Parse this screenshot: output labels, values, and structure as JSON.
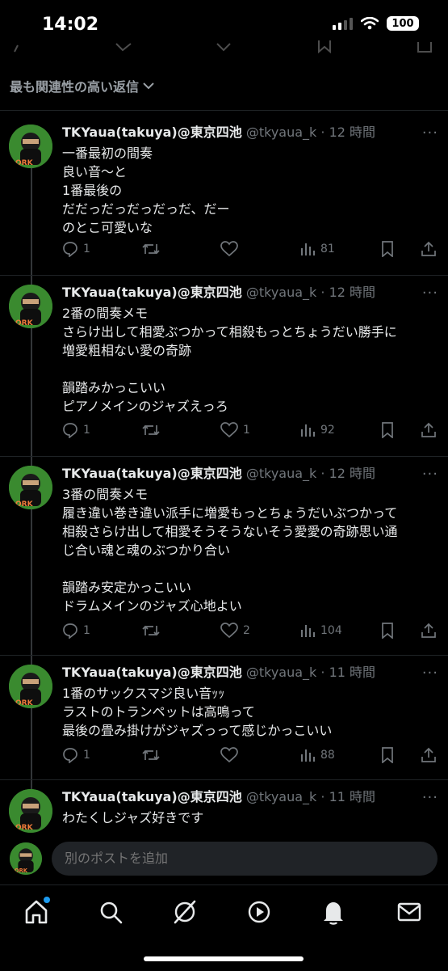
{
  "status": {
    "time": "14:02",
    "battery": "100"
  },
  "sort_label": "最も関連性の高い返信",
  "author": {
    "name": "TKYaua(takuya)@東京四池",
    "handle": "@tkyaua_k"
  },
  "posts": [
    {
      "time": "12 時間",
      "lines": [
        "一番最初の間奏",
        "良い音〜と",
        "1番最後の",
        "だだっだっだっだっだ、だー",
        "のとこ可愛いな"
      ],
      "replies": "1",
      "reposts": "",
      "likes": "",
      "views": "81"
    },
    {
      "time": "12 時間",
      "lines": [
        "2番の間奏メモ",
        "さらけ出して相愛ぶつかって相殺もっとちょうだい勝手に",
        "増愛粗相ない愛の奇跡",
        "",
        "韻踏みかっこいい",
        "ピアノメインのジャズえっろ"
      ],
      "replies": "1",
      "reposts": "",
      "likes": "1",
      "views": "92"
    },
    {
      "time": "12 時間",
      "lines": [
        "3番の間奏メモ",
        "履き違い巻き違い派手に増愛もっとちょうだいぶつかって",
        "相殺さらけ出して相愛そうそうないそう愛愛の奇跡思い通",
        "じ合い魂と魂のぶつかり合い",
        "",
        "韻踏み安定かっこいい",
        "ドラムメインのジャズ心地よい"
      ],
      "replies": "1",
      "reposts": "",
      "likes": "2",
      "views": "104"
    },
    {
      "time": "11 時間",
      "lines": [
        "1番のサックスマジ良い音ｯｯ",
        "ラストのトランペットは高鳴って",
        "最後の畳み掛けがジャズっって感じかっこいい"
      ],
      "replies": "1",
      "reposts": "",
      "likes": "",
      "views": "88"
    },
    {
      "time": "11 時間",
      "lines": [
        "わたくしジャズ好きです"
      ],
      "replies": "",
      "reposts": "",
      "likes": "",
      "views": ""
    }
  ],
  "composer": {
    "placeholder": "別のポストを追加"
  },
  "tabs": [
    {
      "name": "home",
      "icon": "home-icon",
      "badge": true
    },
    {
      "name": "search",
      "icon": "search-icon",
      "badge": false
    },
    {
      "name": "grok",
      "icon": "grok-icon",
      "badge": false
    },
    {
      "name": "video",
      "icon": "play-icon",
      "badge": false
    },
    {
      "name": "notifications",
      "icon": "bell-icon",
      "badge": false
    },
    {
      "name": "messages",
      "icon": "mail-icon",
      "badge": false
    }
  ],
  "colors": {
    "accent": "#1d9bf0",
    "muted": "#71767b",
    "text": "#e7e9ea",
    "background": "#000000"
  }
}
